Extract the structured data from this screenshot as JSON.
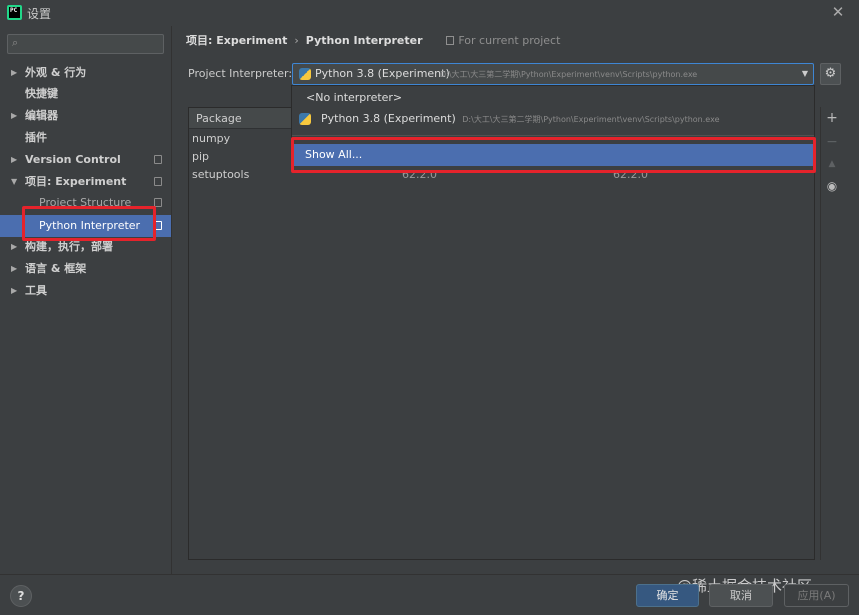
{
  "window": {
    "title": "设置"
  },
  "sidebar": {
    "search_placeholder": "",
    "items": [
      {
        "label": "外观 & 行为",
        "arrow": "▶"
      },
      {
        "label": "快捷键"
      },
      {
        "label": "编辑器",
        "arrow": "▶"
      },
      {
        "label": "插件"
      },
      {
        "label": "Version Control",
        "arrow": "▶"
      },
      {
        "label": "项目: Experiment",
        "arrow": "▼"
      },
      {
        "label": "Project Structure"
      },
      {
        "label": "Python Interpreter"
      },
      {
        "label": "构建，执行，部署",
        "arrow": "▶"
      },
      {
        "label": "语言 & 框架",
        "arrow": "▶"
      },
      {
        "label": "工具",
        "arrow": "▶"
      }
    ]
  },
  "breadcrumb": {
    "project": "项目: Experiment",
    "separator": "›",
    "page": "Python Interpreter",
    "scope": "For current project"
  },
  "interpreter": {
    "label": "Project Interpreter:",
    "name": "Python 3.8 (Experiment)",
    "path": "D:\\大工\\大三第二学期\\Python\\Experiment\\venv\\Scripts\\python.exe"
  },
  "dropdown": {
    "no_interpreter": "<No interpreter>",
    "option_name": "Python 3.8 (Experiment)",
    "option_path": "D:\\大工\\大三第二学期\\Python\\Experiment\\venv\\Scripts\\python.exe",
    "show_all": "Show All..."
  },
  "table": {
    "headers": {
      "package": "Package"
    },
    "rows": [
      {
        "package": "numpy",
        "version": "",
        "latest": ""
      },
      {
        "package": "pip",
        "version": "",
        "latest": ""
      },
      {
        "package": "setuptools",
        "version": "62.2.0",
        "latest": "62.2.0"
      }
    ]
  },
  "tools": {
    "add": "+",
    "remove": "−",
    "upgrade": "▲",
    "show": "◉"
  },
  "footer": {
    "help": "?",
    "ok": "确定",
    "cancel": "取消",
    "apply": "应用(A)",
    "watermark": "@稀土掘金技术社区"
  },
  "colors": {
    "selection": "#4b6eaf",
    "highlight": "#e5232b",
    "background": "#3c3f41"
  }
}
